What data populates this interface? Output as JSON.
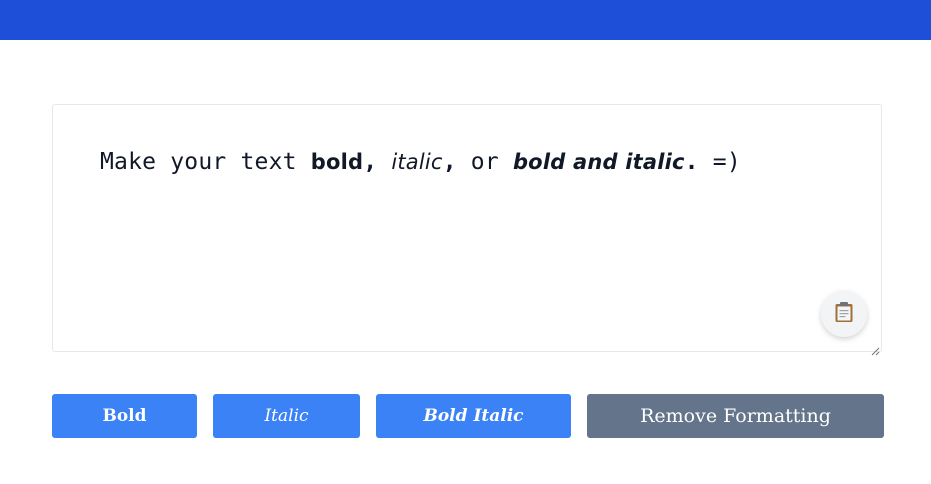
{
  "colors": {
    "header": "#1d4fd8",
    "primary_button": "#3b82f6",
    "secondary_button": "#64748b",
    "text": "#111827"
  },
  "editor": {
    "text_segments": [
      {
        "style": "normal",
        "text": "Make your text "
      },
      {
        "style": "bold",
        "text": "bold"
      },
      {
        "style": "mono-bold",
        "text": ", "
      },
      {
        "style": "italic",
        "text": "italic"
      },
      {
        "style": "mono-bold",
        "text": ","
      },
      {
        "style": "normal",
        "text": " or "
      },
      {
        "style": "bold-italic",
        "text": "bold and italic"
      },
      {
        "style": "mono-bold",
        "text": "."
      },
      {
        "style": "normal",
        "text": " =)"
      }
    ],
    "copy_icon": "clipboard-icon"
  },
  "buttons": {
    "bold": "Bold",
    "italic": "Italic",
    "bold_italic": "Bold Italic",
    "remove": "Remove Formatting"
  }
}
